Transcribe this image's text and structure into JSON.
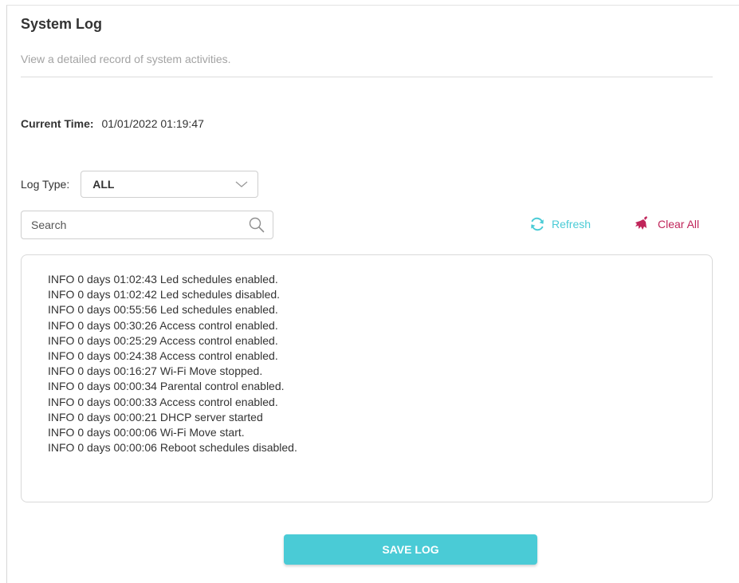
{
  "page": {
    "title": "System Log",
    "subtitle": "View a detailed record of system activities."
  },
  "current_time": {
    "label": "Current Time:",
    "value": "01/01/2022 01:19:47"
  },
  "log_type": {
    "label": "Log Type:",
    "selected": "ALL",
    "icon": "chevron-down-icon"
  },
  "search": {
    "placeholder": "Search",
    "value": "",
    "icon": "search-icon"
  },
  "actions": {
    "refresh_label": "Refresh",
    "refresh_icon": "refresh-icon",
    "clear_label": "Clear All",
    "clear_icon": "broom-icon"
  },
  "logs": [
    "INFO 0 days 01:02:43 Led schedules enabled.",
    "INFO 0 days 01:02:42 Led schedules disabled.",
    "INFO 0 days 00:55:56 Led schedules enabled.",
    "INFO 0 days 00:30:26 Access control enabled.",
    "INFO 0 days 00:25:29 Access control enabled.",
    "INFO 0 days 00:24:38 Access control enabled.",
    "INFO 0 days 00:16:27 Wi-Fi Move stopped.",
    "INFO 0 days 00:00:34 Parental control enabled.",
    "INFO 0 days 00:00:33 Access control enabled.",
    "INFO 0 days 00:00:21 DHCP server started",
    "INFO 0 days 00:00:06 Wi-Fi Move start.",
    "INFO 0 days 00:00:06 Reboot schedules disabled."
  ],
  "save_button_label": "SAVE LOG",
  "colors": {
    "accent": "#4acbd6",
    "clear": "#c0255a",
    "text": "#333333",
    "muted": "#a3a3a3"
  }
}
